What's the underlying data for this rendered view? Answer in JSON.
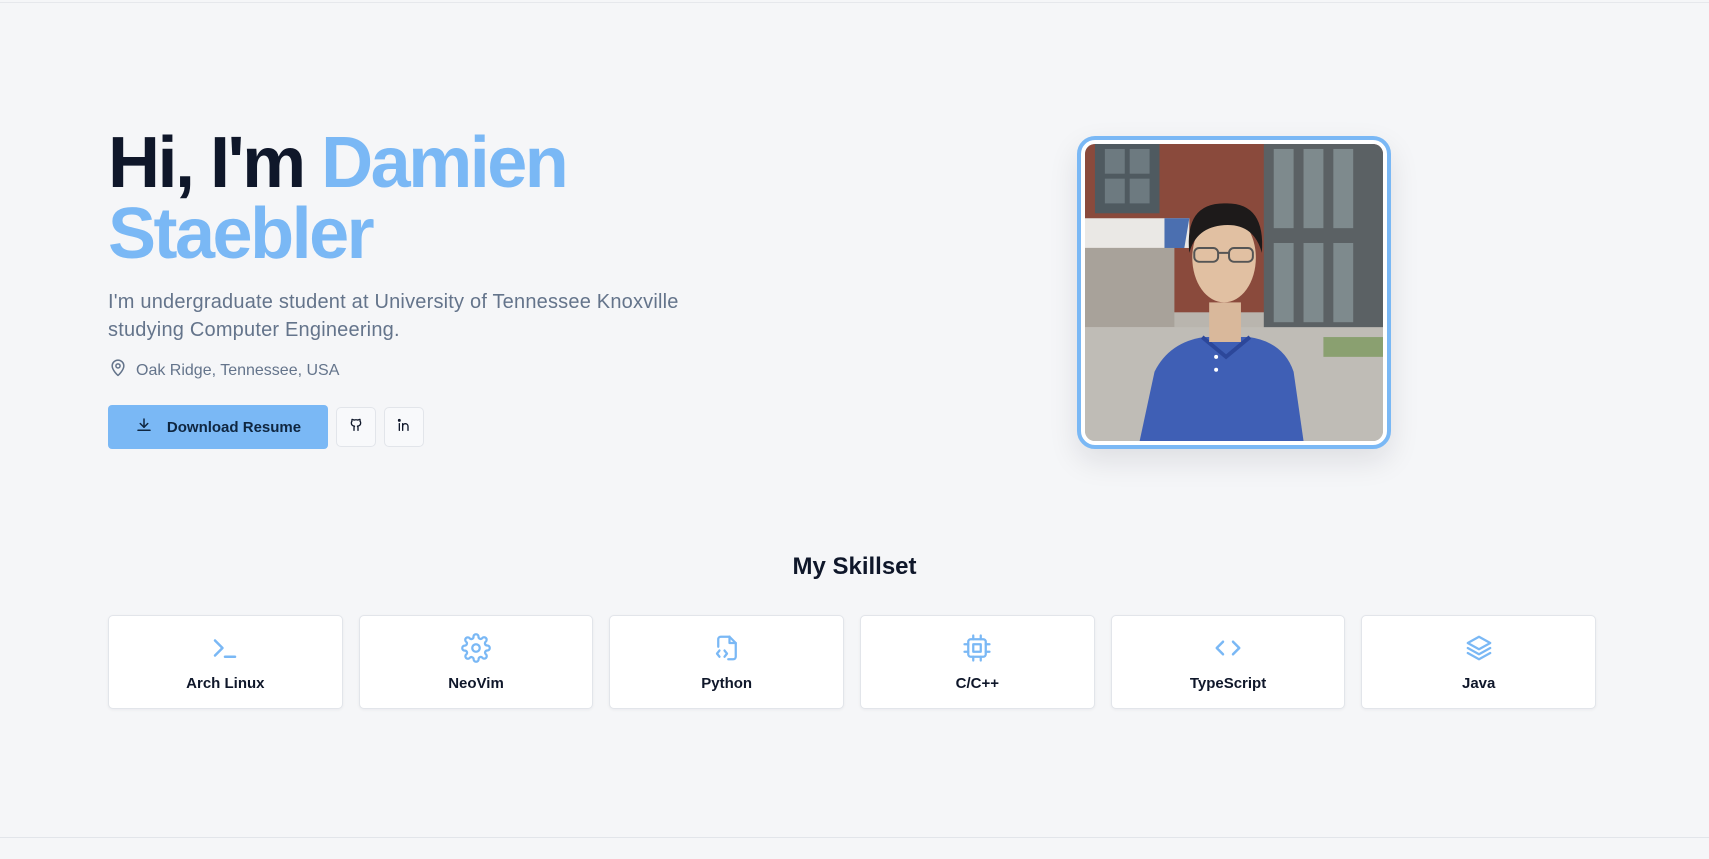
{
  "hero": {
    "greeting": "Hi, I'm ",
    "first_name": "Damien",
    "last_name": "Staebler",
    "subtitle": "I'm undergraduate student at University of Tennessee Knoxville studying Computer Engineering.",
    "location": "Oak Ridge, Tennessee, USA",
    "download_label": "Download Resume",
    "accent_color": "#7ab8f5"
  },
  "skills": {
    "title": "My Skillset",
    "items": [
      {
        "label": "Arch Linux",
        "icon": "terminal-icon"
      },
      {
        "label": "NeoVim",
        "icon": "gear-icon"
      },
      {
        "label": "Python",
        "icon": "file-code-icon"
      },
      {
        "label": "C/C++",
        "icon": "cpu-chip-icon"
      },
      {
        "label": "TypeScript",
        "icon": "code-brackets-icon"
      },
      {
        "label": "Java",
        "icon": "layers-icon"
      }
    ]
  }
}
